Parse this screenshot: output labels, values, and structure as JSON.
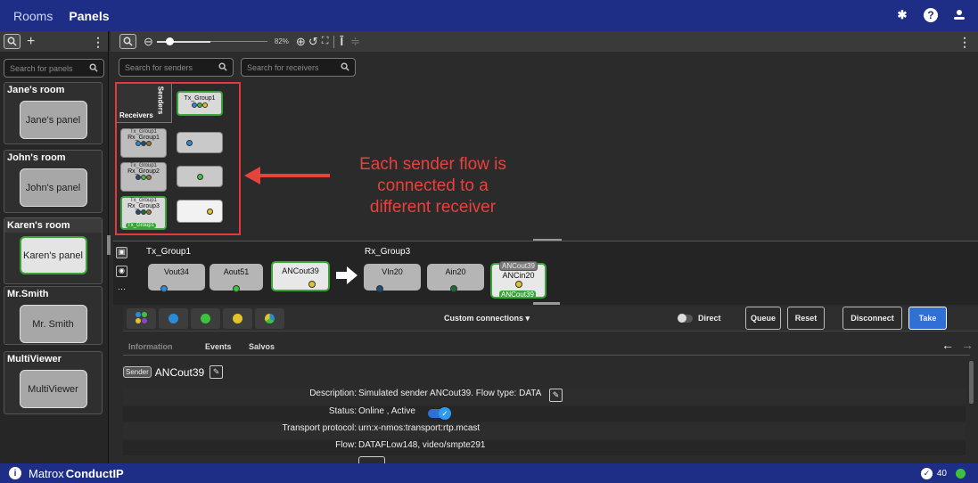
{
  "topbar": {
    "tabs": [
      "Rooms",
      "Panels"
    ]
  },
  "left": {
    "search_placeholder": "Search for panels",
    "rooms": [
      {
        "title": "Jane's room",
        "panel": "Jane's panel"
      },
      {
        "title": "John's room",
        "panel": "John's panel"
      },
      {
        "title": "Karen's room",
        "panel": "Karen's panel"
      },
      {
        "title": "Mr.Smith",
        "panel": "Mr. Smith"
      },
      {
        "title": "MultiViewer",
        "panel": "MultiViewer"
      }
    ]
  },
  "toolbar": {
    "zoom": "82%",
    "senders_placeholder": "Search for senders",
    "receivers_placeholder": "Search for receivers"
  },
  "matrix": {
    "senders_label": "Senders",
    "receivers_label": "Receivers",
    "sender": "Tx_Group1",
    "receivers": [
      {
        "top": "Tx_Group1",
        "name": "Rx_Group1"
      },
      {
        "top": "Tx_Group1",
        "name": "Rx_Group2"
      },
      {
        "top": "Tx_Group1",
        "name": "Rx_Group3",
        "bottom": "Tx_Group1"
      }
    ]
  },
  "annotation": {
    "line1": "Each sender flow is",
    "line2": "connected to a",
    "line3": "different receiver"
  },
  "flow": {
    "tx_title": "Tx_Group1",
    "rx_title": "Rx_Group3",
    "tx_items": [
      "Vout34",
      "Aout51",
      "ANCout39"
    ],
    "rx_items": [
      "VIn20",
      "Ain20",
      "ANCin20"
    ],
    "rx_tag_top": "ANCout39",
    "rx_tag_bottom": "ANCout39"
  },
  "controls": {
    "custom": "Custom connections",
    "direct": "Direct",
    "queue": "Queue",
    "reset": "Reset",
    "disconnect": "Disconnect",
    "take": "Take"
  },
  "tabs": {
    "information": "Information",
    "events": "Events",
    "salvos": "Salvos"
  },
  "info": {
    "badge": "Sender",
    "name": "ANCout39",
    "rows": [
      {
        "label": "Description:",
        "value": "Simulated sender ANCout39. Flow type: DATA"
      },
      {
        "label": "Status:",
        "value": "Online , Active"
      },
      {
        "label": "Transport protocol:",
        "value": "urn:x-nmos:transport:rtp.mcast"
      },
      {
        "label": "Flow:",
        "value": "DATAFLow148, video/smpte291"
      }
    ]
  },
  "status": {
    "brand": "Matrox",
    "product": "ConductIP",
    "count": "40"
  },
  "colors": {
    "topbar": "#1e2d86",
    "selected": "#3aa33a",
    "annotation": "#e7423c",
    "take": "#2f6fd6"
  }
}
